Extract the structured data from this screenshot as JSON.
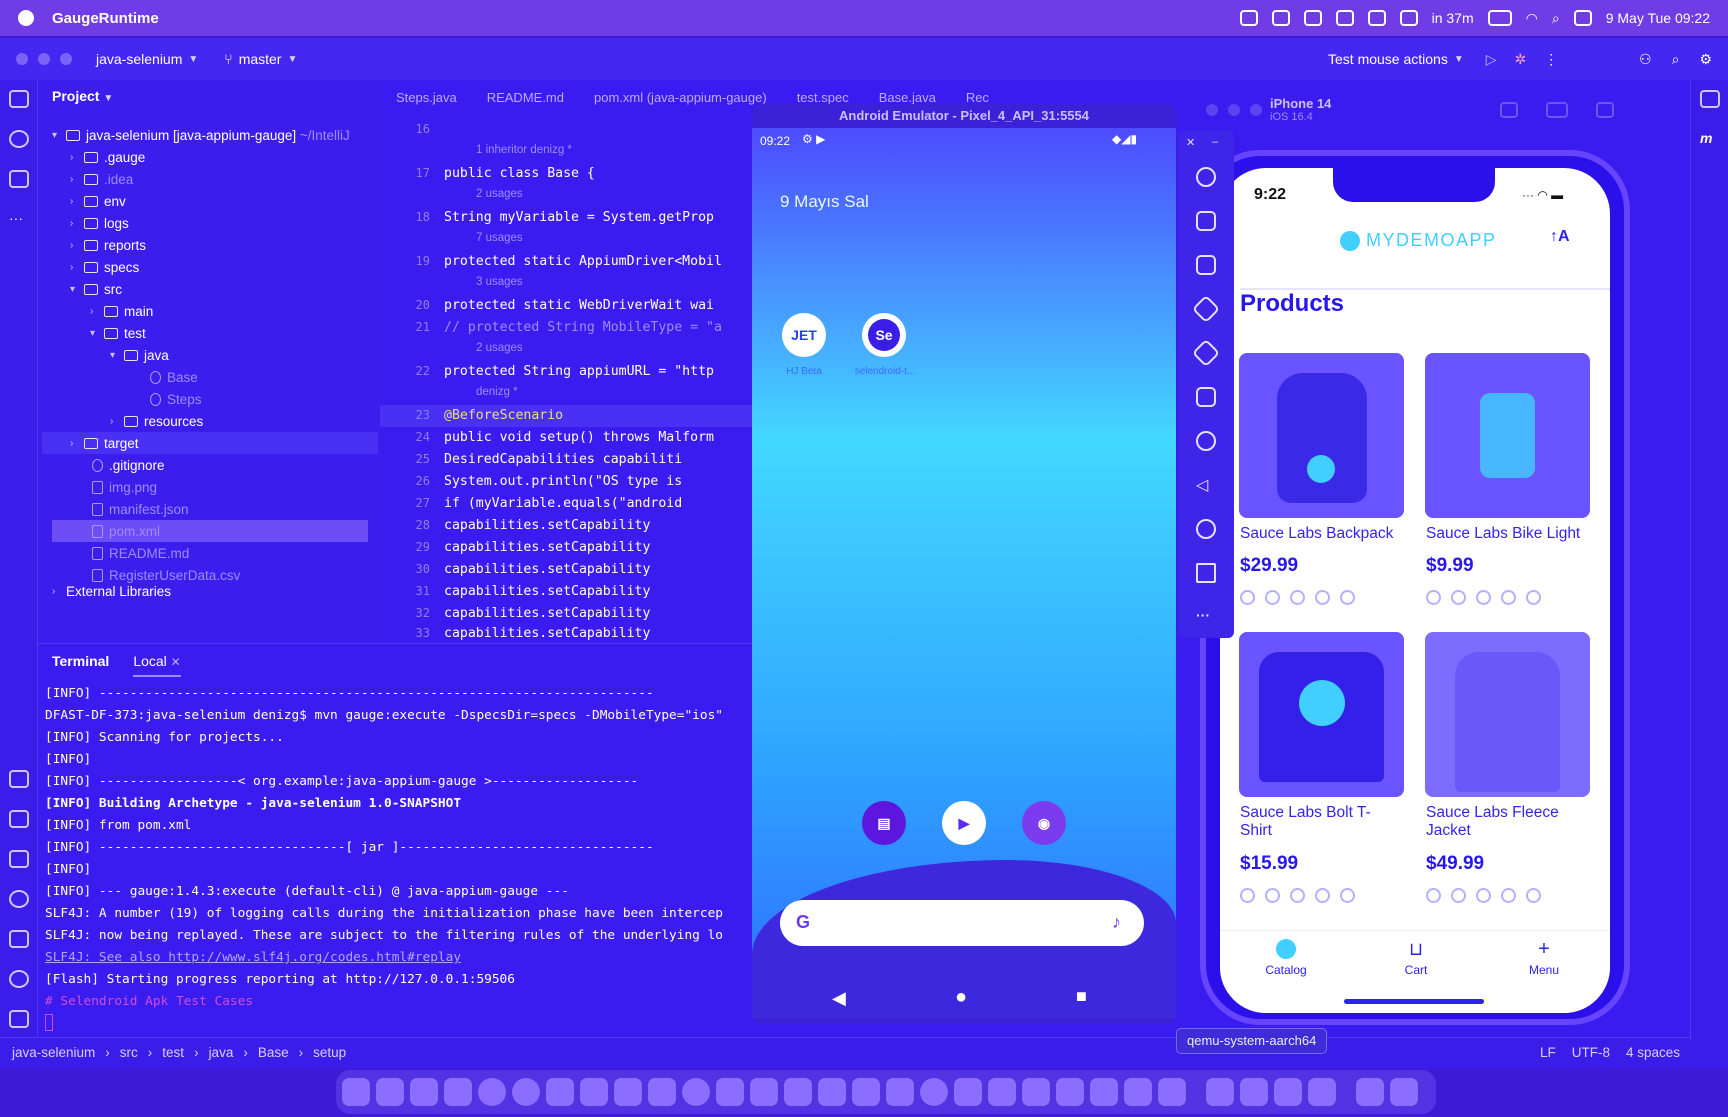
{
  "menubar": {
    "app_name": "GaugeRuntime",
    "timer": "in 37m",
    "datetime": "9 May Tue  09:22"
  },
  "toolbar": {
    "project": "java-selenium",
    "branch": "master",
    "run_config": "Test mouse actions"
  },
  "project_panel": {
    "title": "Project",
    "root": "java-selenium [java-appium-gauge]",
    "root_path": "~/IntelliJ",
    "items": [
      {
        "label": ".gauge",
        "type": "folder"
      },
      {
        "label": ".idea",
        "type": "folder"
      },
      {
        "label": "env",
        "type": "folder"
      },
      {
        "label": "logs",
        "type": "folder"
      },
      {
        "label": "reports",
        "type": "folder"
      },
      {
        "label": "specs",
        "type": "folder"
      },
      {
        "label": "src",
        "type": "folder"
      },
      {
        "label": "main",
        "type": "folder"
      },
      {
        "label": "test",
        "type": "folder"
      },
      {
        "label": "java",
        "type": "folder"
      },
      {
        "label": "Base",
        "type": "class"
      },
      {
        "label": "Steps",
        "type": "class"
      },
      {
        "label": "resources",
        "type": "folder"
      },
      {
        "label": "target",
        "type": "folder"
      },
      {
        "label": ".gitignore",
        "type": "file"
      },
      {
        "label": "img.png",
        "type": "file"
      },
      {
        "label": "manifest.json",
        "type": "file"
      },
      {
        "label": "pom.xml",
        "type": "file"
      },
      {
        "label": "README.md",
        "type": "file"
      },
      {
        "label": "RegisterUserData.csv",
        "type": "file"
      },
      {
        "label": "External Libraries",
        "type": "folder"
      }
    ]
  },
  "editor": {
    "tabs": [
      "Steps.java",
      "README.md",
      "pom.xml (java-appium-gauge)",
      "test.spec",
      "Base.java",
      "Rec"
    ],
    "lines": [
      {
        "n": "16",
        "hint": "1 inheritor   denizg *",
        "code": ""
      },
      {
        "n": "17",
        "hint": "",
        "code": "public class Base {"
      },
      {
        "n": "",
        "hint": "2 usages",
        "code": ""
      },
      {
        "n": "18",
        "hint": "",
        "code": "    String myVariable = System.getProp"
      },
      {
        "n": "",
        "hint": "7 usages",
        "code": ""
      },
      {
        "n": "19",
        "hint": "",
        "code": "    protected static AppiumDriver<Mobil"
      },
      {
        "n": "",
        "hint": "3 usages",
        "code": ""
      },
      {
        "n": "20",
        "hint": "",
        "code": "    protected static WebDriverWait wai"
      },
      {
        "n": "21",
        "hint": "",
        "code": "//    protected String MobileType = \"a"
      },
      {
        "n": "",
        "hint": "2 usages",
        "code": ""
      },
      {
        "n": "22",
        "hint": "",
        "code": "    protected String appiumURL = \"http"
      },
      {
        "n": "",
        "hint": "denizg *",
        "code": ""
      },
      {
        "n": "23",
        "hint": "",
        "code": "    @BeforeScenario"
      },
      {
        "n": "24",
        "hint": "",
        "code": "    public void setup() throws Malform"
      },
      {
        "n": "25",
        "hint": "",
        "code": "        DesiredCapabilities capabiliti"
      },
      {
        "n": "26",
        "hint": "",
        "code": "        System.out.println(\"OS type is"
      },
      {
        "n": "27",
        "hint": "",
        "code": "        if (myVariable.equals(\"android"
      },
      {
        "n": "28",
        "hint": "",
        "code": "            capabilities.setCapability"
      },
      {
        "n": "29",
        "hint": "",
        "code": "            capabilities.setCapability"
      },
      {
        "n": "30",
        "hint": "",
        "code": "            capabilities.setCapability"
      },
      {
        "n": "31",
        "hint": "",
        "code": "            capabilities.setCapability"
      },
      {
        "n": "32",
        "hint": "",
        "code": "            capabilities.setCapability"
      },
      {
        "n": "33",
        "hint": "",
        "code": "            capabilities.setCapability"
      }
    ]
  },
  "terminal": {
    "tab_title": "Terminal",
    "tab_local": "Local",
    "lines": [
      "[INFO] ------------------------------------------------------------------------",
      "DFAST-DF-373:java-selenium denizg$ mvn gauge:execute -DspecsDir=specs -DMobileType=\"ios\"",
      "[INFO] Scanning for projects...",
      "[INFO]",
      "[INFO] ------------------< org.example:java-appium-gauge >-------------------",
      "[INFO] Building Archetype - java-selenium 1.0-SNAPSHOT",
      "[INFO]   from pom.xml",
      "[INFO] --------------------------------[ jar ]---------------------------------",
      "[INFO]",
      "[INFO] --- gauge:1.4.3:execute (default-cli) @ java-appium-gauge ---",
      "SLF4J: A number (19) of logging calls during the initialization phase have been intercep",
      "SLF4J: now being replayed. These are subject to the filtering rules of the underlying lo",
      "SLF4J: See also http://www.slf4j.org/codes.html#replay",
      "[Flash] Starting progress reporting at http://127.0.0.1:59506",
      "# Selendroid Apk Test Cases"
    ]
  },
  "statusbar": {
    "crumbs": [
      "java-selenium",
      "src",
      "test",
      "java",
      "Base",
      "setup"
    ],
    "line_sep": "LF",
    "encoding": "UTF-8",
    "indent": "4 spaces"
  },
  "android": {
    "title": "Android Emulator - Pixel_4_API_31:5554",
    "time": "09:22",
    "date": "9 Mayıs Sal",
    "app1_icon": "JET",
    "app1": "HJ Beta",
    "app2_icon": "Se",
    "app2": "selendroid-t..."
  },
  "ios": {
    "device": "iPhone 14",
    "os": "iOS 16.4",
    "time": "9:22",
    "brand": "MYDEMOAPP",
    "heading": "Products",
    "products": [
      {
        "name": "Sauce Labs Backpack",
        "price": "$29.99",
        "rating": 0
      },
      {
        "name": "Sauce Labs Bike Light",
        "price": "$9.99",
        "rating": 0
      },
      {
        "name": "Sauce Labs Bolt T-Shirt",
        "price": "$15.99",
        "rating": 0
      },
      {
        "name": "Sauce Labs Fleece Jacket",
        "price": "$49.99",
        "rating": 0
      }
    ],
    "tabs": [
      "Catalog",
      "Cart",
      "Menu"
    ]
  },
  "dock": {
    "tooltip": "qemu-system-aarch64"
  },
  "colors": {
    "accent": "#3a1cf0",
    "menubar": "#6f3ce6",
    "ios_text": "#2b22f2"
  }
}
